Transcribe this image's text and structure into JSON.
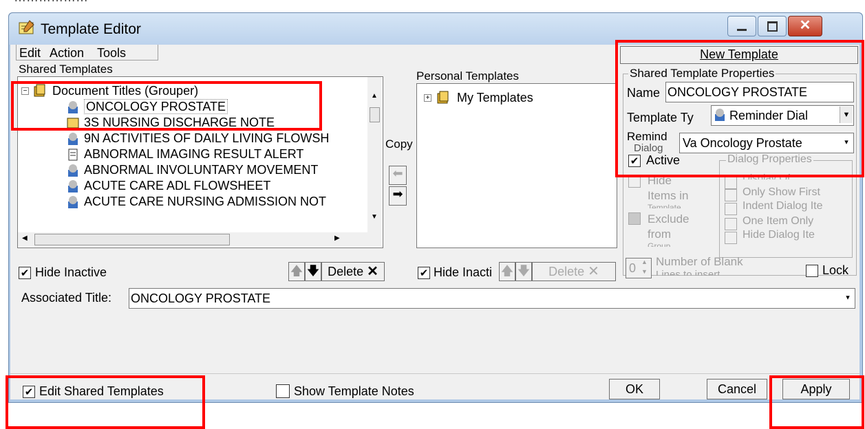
{
  "window": {
    "title": "Template Editor"
  },
  "menu": {
    "items": [
      "Edit",
      "Action",
      "Tools"
    ]
  },
  "shared": {
    "label": "Shared Templates",
    "root": "Document Titles (Grouper)",
    "items": [
      "ONCOLOGY PROSTATE",
      "3S NURSING DISCHARGE NOTE",
      "9N ACTIVITIES OF DAILY LIVING FLOWSH",
      "ABNORMAL IMAGING RESULT ALERT",
      "ABNORMAL INVOLUNTARY MOVEMENT",
      "ACUTE CARE ADL FLOWSHEET",
      "ACUTE CARE NURSING ADMISSION NOT"
    ],
    "hide_inactive": "Hide Inactive",
    "delete": "Delete"
  },
  "copy_label": "Copy",
  "personal": {
    "label": "Personal Templates",
    "root": "My Templates",
    "hide_inactive": "Hide Inacti",
    "delete": "Delete"
  },
  "properties": {
    "new_template": "New Template",
    "group_label": "Shared Template Properties",
    "name_label": "Name",
    "name_value": "ONCOLOGY PROSTATE",
    "type_label": "Template Ty",
    "type_value": "Reminder Dial",
    "reminder_label": "Remind",
    "reminder_label2": "Dialog",
    "reminder_value": "Va Oncology Prostate",
    "active_label": "Active",
    "hide_items_label": [
      "Hide",
      "Items in",
      "Template"
    ],
    "exclude_label": [
      "Exclude",
      "from",
      "Group"
    ],
    "dialog_props": {
      "label": "Dialog Properties",
      "items": [
        "Display Of",
        "Only Show First",
        "Indent Dialog Ite",
        "One Item Only",
        "Hide Dialog Ite"
      ]
    },
    "blank_lines_value": "0",
    "blank_lines_label": [
      "Number of Blank",
      "Lines to insert"
    ],
    "lock_label": "Lock"
  },
  "associated": {
    "label": "Associated Title:",
    "value": "ONCOLOGY PROSTATE"
  },
  "footer": {
    "edit_shared": "Edit Shared Templates",
    "show_notes": "Show Template Notes",
    "ok": "OK",
    "cancel": "Cancel",
    "apply": "Apply"
  },
  "colors": {
    "highlight": "#ff0000",
    "titlebar": "#bcd2ec",
    "close": "#c9463d"
  }
}
